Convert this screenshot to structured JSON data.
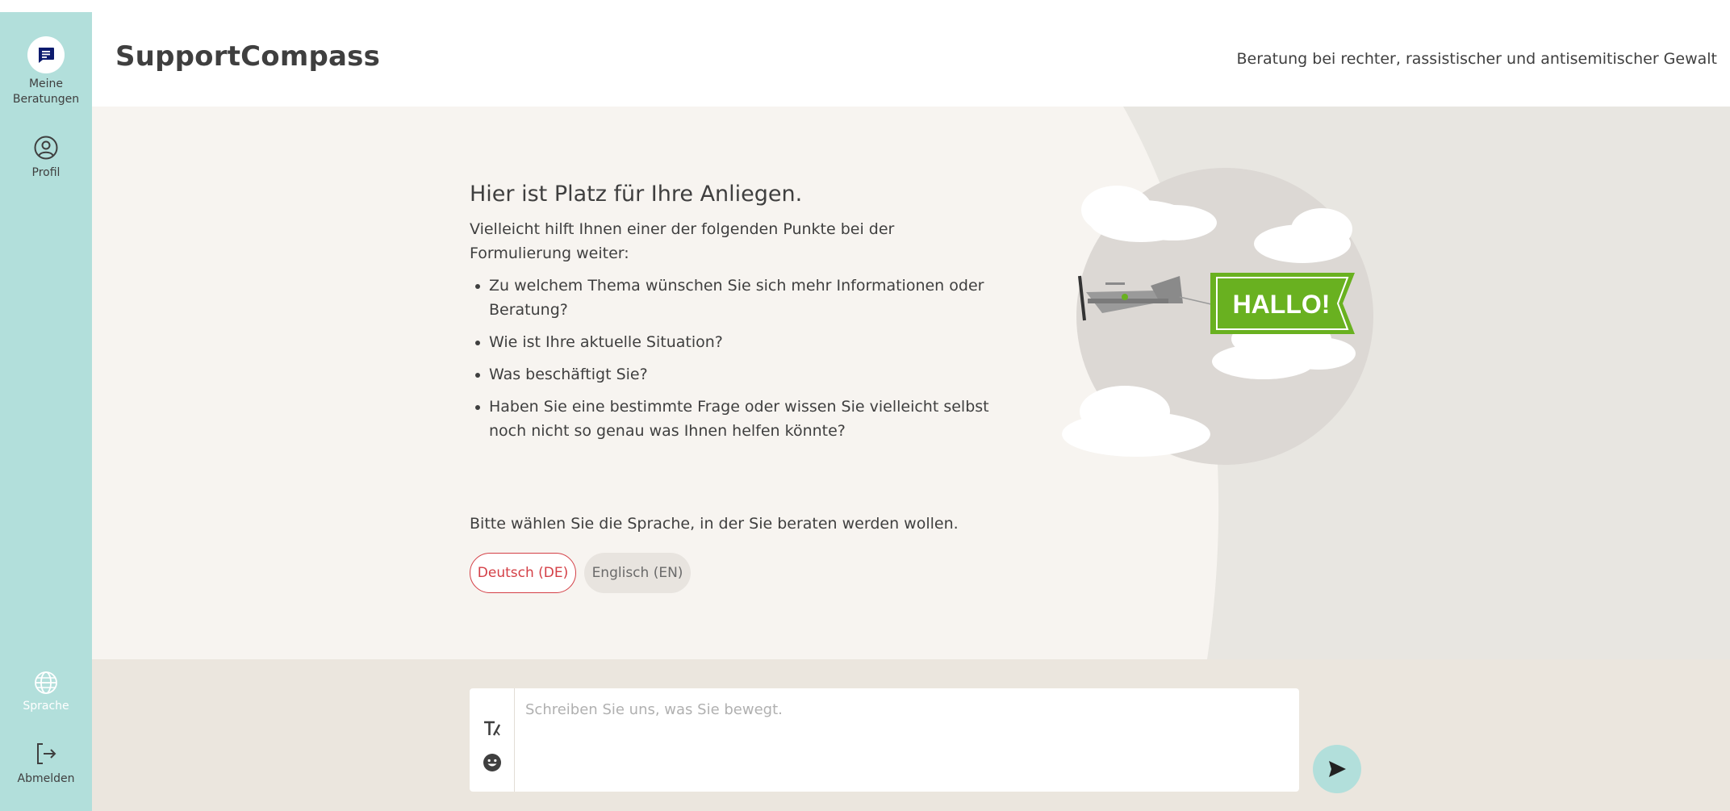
{
  "app": {
    "brand": "SupportCompass",
    "tagline": "Beratung bei rechter, rassistischer und antisemitischer Gewalt"
  },
  "sidebar": {
    "items": [
      {
        "label_line1": "Meine",
        "label_line2": "Beratungen",
        "icon": "chat-bubble-icon",
        "active": true
      },
      {
        "label": "Profil",
        "icon": "user-circle-icon"
      },
      {
        "label": "Sprache",
        "icon": "globe-icon"
      },
      {
        "label": "Abmelden",
        "icon": "logout-icon"
      }
    ]
  },
  "main": {
    "heading": "Hier ist Platz für Ihre Anliegen.",
    "intro": "Vielleicht hilft Ihnen einer der folgenden Punkte bei der Formulierung weiter:",
    "bullets": [
      "Zu welchem Thema wünschen Sie sich mehr Informationen oder Beratung?",
      "Wie ist Ihre aktuelle Situation?",
      "Was beschäftigt Sie?",
      "Haben Sie eine bestimmte Frage oder wissen Sie vielleicht selbst noch nicht so genau was Ihnen helfen könnte?"
    ],
    "illustration": {
      "banner_text": "HALLO!",
      "banner_color": "#69b120"
    },
    "language_prompt": "Bitte wählen Sie die Sprache, in der Sie beraten werden wollen.",
    "languages": [
      {
        "label": "Deutsch (DE)",
        "selected": true
      },
      {
        "label": "Englisch (EN)",
        "selected": false
      }
    ]
  },
  "composer": {
    "placeholder": "Schreiben Sie uns, was Sie bewegt.",
    "value": "",
    "tools": [
      "text-format-icon",
      "emoji-icon"
    ],
    "send_icon": "send-icon"
  },
  "colors": {
    "sidebar": "#b2dfdb",
    "accent_red": "#d43f46",
    "main_bg": "#f7f4f0",
    "footer_bg": "#ebe6de",
    "icon_dark": "#0d1b6e"
  }
}
